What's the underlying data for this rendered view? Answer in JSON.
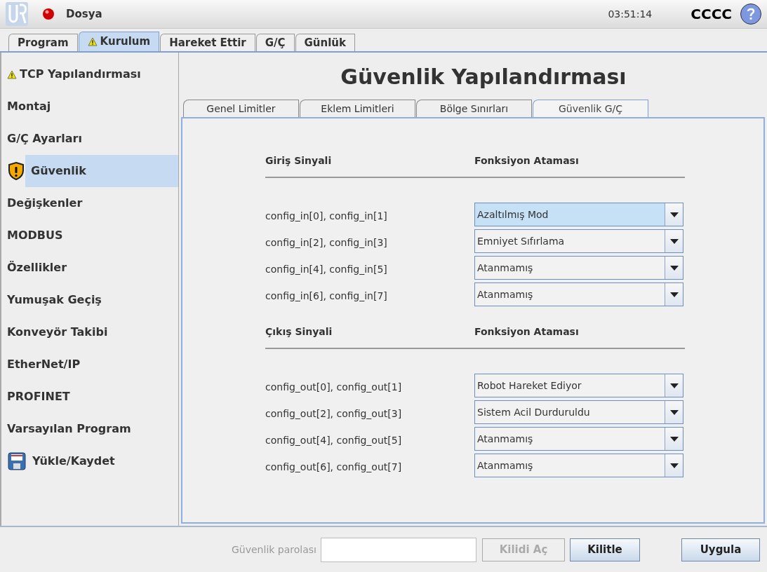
{
  "header": {
    "menu": "Dosya",
    "time": "03:51:14",
    "robot_name": "CCCC"
  },
  "main_tabs": [
    {
      "label": "Program",
      "selected": false,
      "warning": false
    },
    {
      "label": "Kurulum",
      "selected": true,
      "warning": true
    },
    {
      "label": "Hareket Ettir",
      "selected": false,
      "warning": false
    },
    {
      "label": "G/Ç",
      "selected": false,
      "warning": false
    },
    {
      "label": "Günlük",
      "selected": false,
      "warning": false
    }
  ],
  "sidebar": {
    "items": [
      {
        "label": "TCP Yapılandırması",
        "kind": "warning",
        "selected": false
      },
      {
        "label": "Montaj",
        "kind": "plain",
        "selected": false
      },
      {
        "label": "G/Ç Ayarları",
        "kind": "plain",
        "selected": false
      },
      {
        "label": "Güvenlik",
        "kind": "shield",
        "selected": true
      },
      {
        "label": "Değişkenler",
        "kind": "plain",
        "selected": false
      },
      {
        "label": "MODBUS",
        "kind": "plain",
        "selected": false
      },
      {
        "label": "Özellikler",
        "kind": "plain",
        "selected": false
      },
      {
        "label": "Yumuşak Geçiş",
        "kind": "plain",
        "selected": false
      },
      {
        "label": "Konveyör Takibi",
        "kind": "plain",
        "selected": false
      },
      {
        "label": "EtherNet/IP",
        "kind": "plain",
        "selected": false
      },
      {
        "label": "PROFINET",
        "kind": "plain",
        "selected": false
      },
      {
        "label": "Varsayılan Program",
        "kind": "plain",
        "selected": false
      },
      {
        "label": "Yükle/Kaydet",
        "kind": "disk",
        "selected": false
      }
    ]
  },
  "content": {
    "title": "Güvenlik Yapılandırması",
    "sub_tabs": [
      {
        "label": "Genel Limitler",
        "selected": false
      },
      {
        "label": "Eklem Limitleri",
        "selected": false
      },
      {
        "label": "Bölge Sınırları",
        "selected": false
      },
      {
        "label": "Güvenlik G/Ç",
        "selected": true
      }
    ],
    "sections": [
      {
        "signal_header": "Giriş Sinyali",
        "function_header": "Fonksiyon Ataması",
        "rows": [
          {
            "signal": "config_in[0], config_in[1]",
            "function": "Azaltılmış Mod",
            "highlighted": true
          },
          {
            "signal": "config_in[2], config_in[3]",
            "function": "Emniyet Sıfırlama",
            "highlighted": false
          },
          {
            "signal": "config_in[4], config_in[5]",
            "function": "Atanmamış",
            "highlighted": false
          },
          {
            "signal": "config_in[6], config_in[7]",
            "function": "Atanmamış",
            "highlighted": false
          }
        ]
      },
      {
        "signal_header": "Çıkış Sinyali",
        "function_header": "Fonksiyon Ataması",
        "rows": [
          {
            "signal": "config_out[0], config_out[1]",
            "function": "Robot Hareket Ediyor",
            "highlighted": false
          },
          {
            "signal": "config_out[2], config_out[3]",
            "function": "Sistem Acil Durduruldu",
            "highlighted": false
          },
          {
            "signal": "config_out[4], config_out[5]",
            "function": "Atanmamış",
            "highlighted": false
          },
          {
            "signal": "config_out[6], config_out[7]",
            "function": "Atanmamış",
            "highlighted": false
          }
        ]
      }
    ]
  },
  "footer": {
    "password_label": "Güvenlik parolası",
    "buttons": [
      {
        "label": "Kilidi Aç",
        "disabled": true
      },
      {
        "label": "Kilitle",
        "disabled": false
      },
      {
        "label": "Uygula",
        "disabled": false
      }
    ]
  }
}
